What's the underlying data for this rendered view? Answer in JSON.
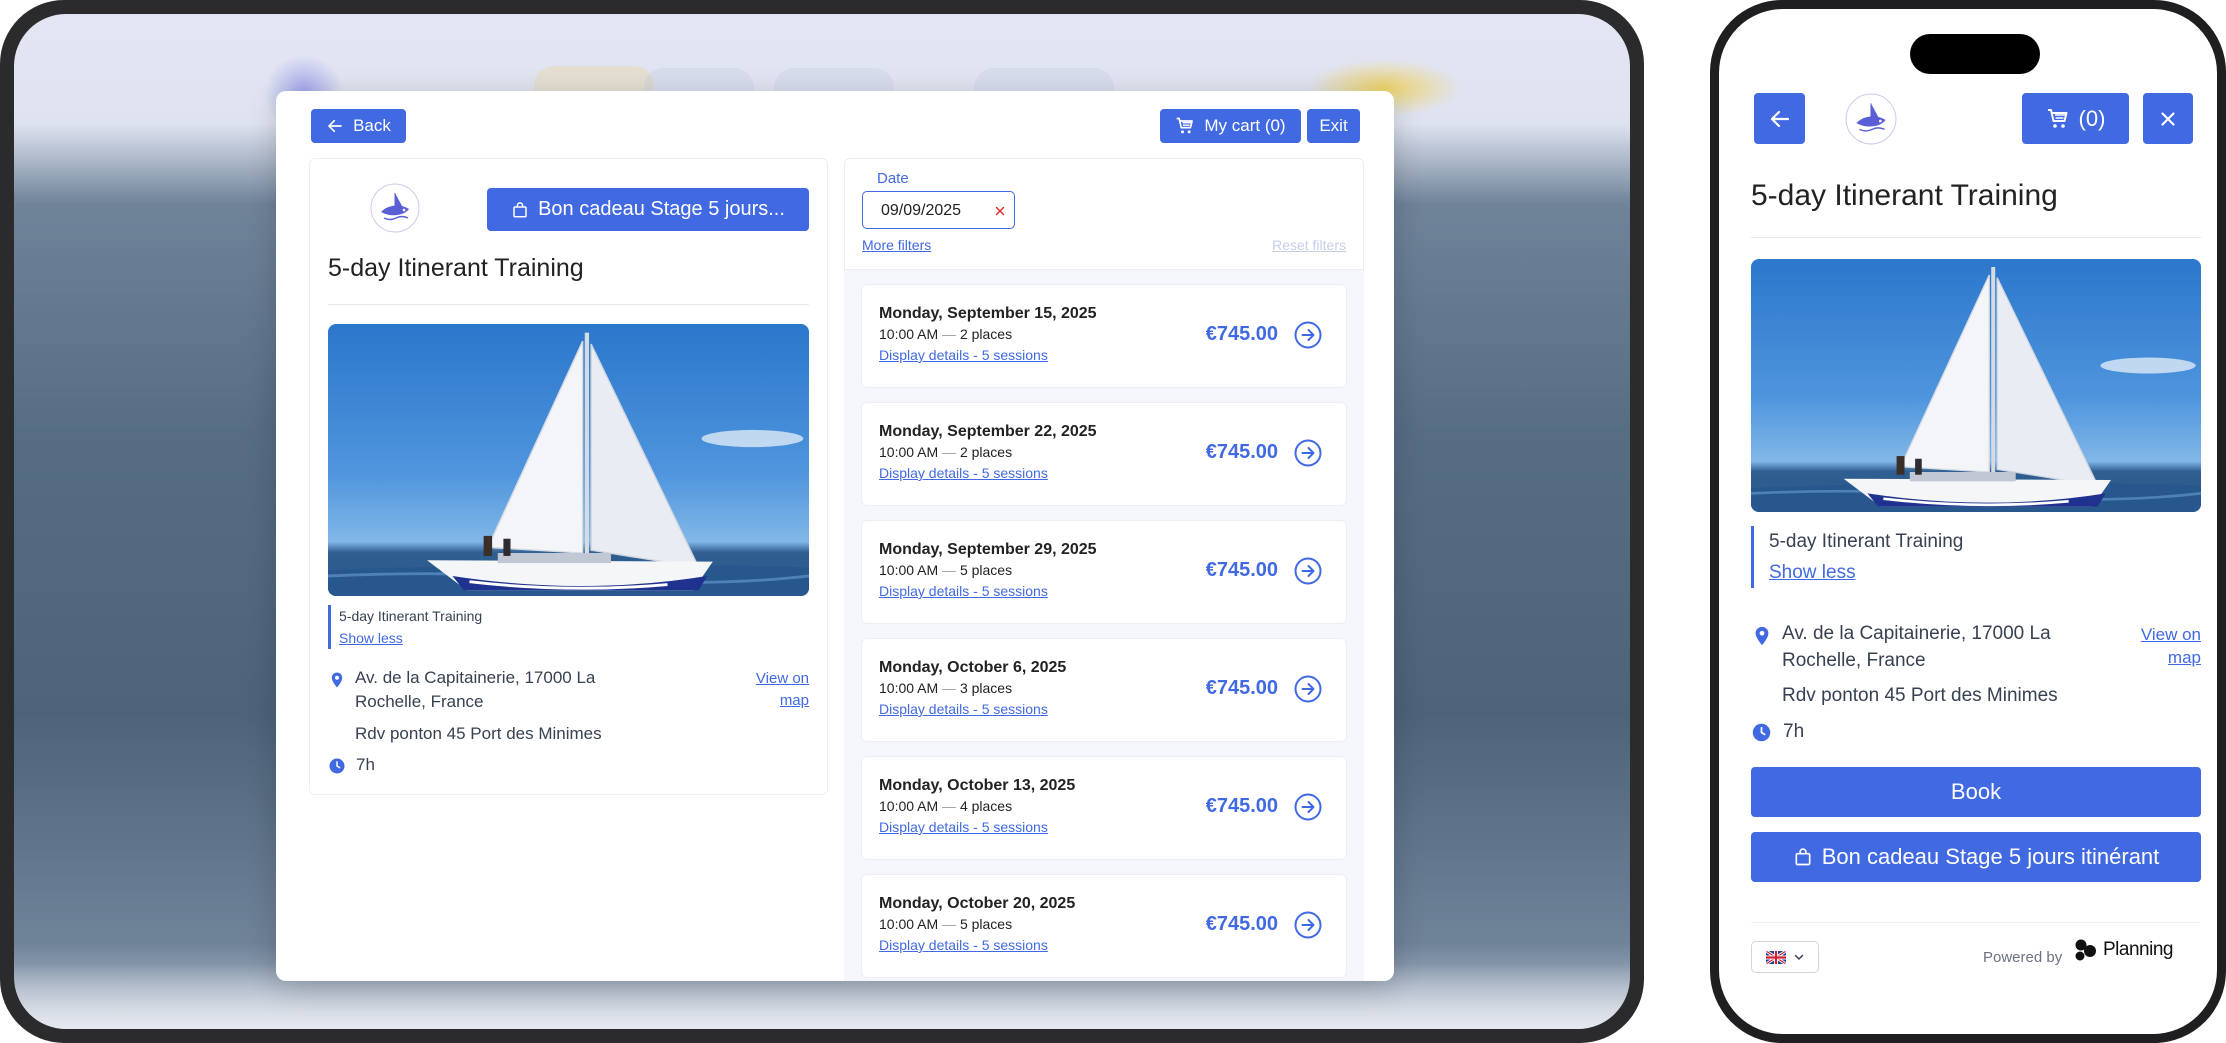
{
  "colors": {
    "accent": "#4169e1",
    "danger": "#e02424",
    "text": "#1f2937"
  },
  "desktop": {
    "back_label": "Back",
    "cart_label": "My cart (0)",
    "exit_label": "Exit",
    "gift_button_label": "Bon cadeau Stage 5 jours...",
    "activity_title": "5-day Itinerant Training",
    "image_caption": "5-day Itinerant Training",
    "show_less": "Show less",
    "address": "Av. de la Capitainerie, 17000 La Rochelle, France",
    "view_on_map": "View on map",
    "meeting_point": "Rdv ponton 45 Port des Minimes",
    "duration": "7h",
    "filters": {
      "date_label": "Date",
      "date_value": "09/09/2025",
      "more_filters": "More filters",
      "reset_filters": "Reset filters"
    },
    "sessions": [
      {
        "date": "Monday, September 15, 2025",
        "time": "10:00 AM",
        "places": "2 places",
        "details": "Display details - 5 sessions",
        "price": "€745.00"
      },
      {
        "date": "Monday, September 22, 2025",
        "time": "10:00 AM",
        "places": "2 places",
        "details": "Display details - 5 sessions",
        "price": "€745.00"
      },
      {
        "date": "Monday, September 29, 2025",
        "time": "10:00 AM",
        "places": "5 places",
        "details": "Display details - 5 sessions",
        "price": "€745.00"
      },
      {
        "date": "Monday, October 6, 2025",
        "time": "10:00 AM",
        "places": "3 places",
        "details": "Display details - 5 sessions",
        "price": "€745.00"
      },
      {
        "date": "Monday, October 13, 2025",
        "time": "10:00 AM",
        "places": "4 places",
        "details": "Display details - 5 sessions",
        "price": "€745.00"
      },
      {
        "date": "Monday, October 20, 2025",
        "time": "10:00 AM",
        "places": "5 places",
        "details": "Display details - 5 sessions",
        "price": "€745.00"
      }
    ]
  },
  "mobile": {
    "cart_label": "(0)",
    "activity_title": "5-day Itinerant Training",
    "image_caption": "5-day Itinerant Training",
    "show_less": "Show less",
    "address": "Av. de la Capitainerie, 17000 La Rochelle, France",
    "view_on_map": "View on map",
    "meeting_point": "Rdv ponton 45 Port des Minimes",
    "duration": "7h",
    "book_label": "Book",
    "gift_button_label": "Bon cadeau Stage 5 jours itinérant",
    "powered_by": "Powered by",
    "brand_name": "Planning"
  },
  "icons": [
    "arrow-left-icon",
    "cart-icon",
    "gift-bag-icon",
    "map-pin-icon",
    "clock-icon",
    "arrow-circle-right-icon",
    "close-icon",
    "chevron-down-icon",
    "uk-flag-icon"
  ]
}
